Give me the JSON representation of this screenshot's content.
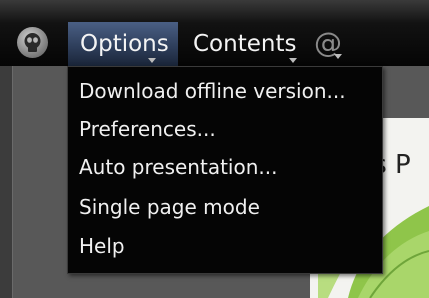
{
  "toolbar": {
    "menus": [
      {
        "label": "Options"
      },
      {
        "label": "Contents"
      }
    ],
    "logo_icon": "skull-icon",
    "at_icon": "@"
  },
  "options_menu": {
    "items": [
      {
        "label": "Download offline version..."
      },
      {
        "label": "Preferences..."
      },
      {
        "label": "Auto presentation..."
      },
      {
        "label": "Single page mode"
      },
      {
        "label": "Help"
      }
    ]
  },
  "content": {
    "title_fragment": "is P"
  },
  "colors": {
    "toolbar_bg": "#050505",
    "active_menu_bg": "#3a4d6e",
    "menu_text": "#f0f0f0",
    "dropdown_bg": "#050505"
  }
}
